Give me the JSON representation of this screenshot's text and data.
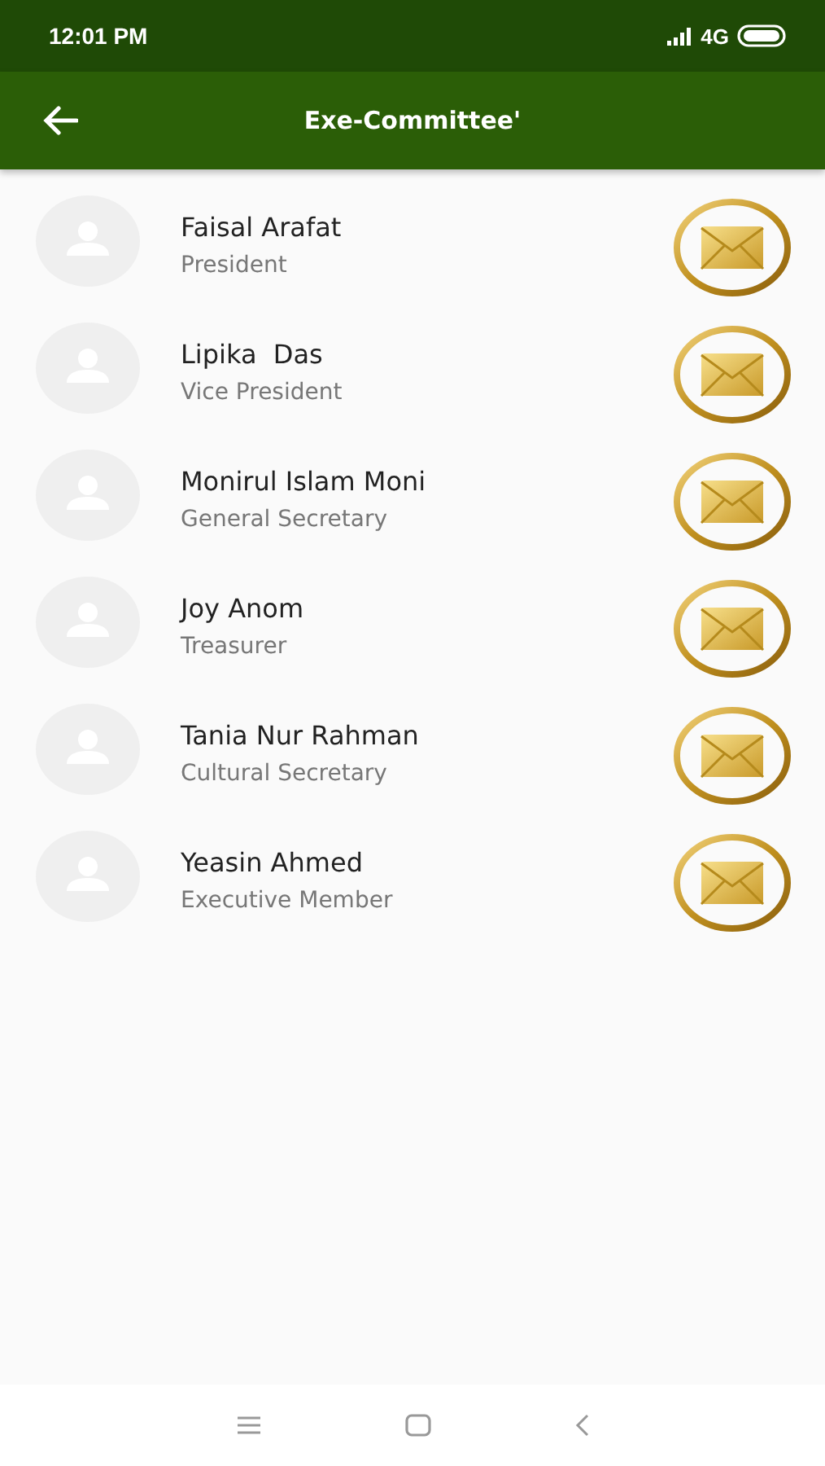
{
  "status_bar": {
    "time": "12:01 PM",
    "network": "4G"
  },
  "app_bar": {
    "title": "Exe-Committee'"
  },
  "members": [
    {
      "name": "Faisal Arafat",
      "role": "President"
    },
    {
      "name": "Lipika  Das",
      "role": "Vice President"
    },
    {
      "name": "Monirul Islam Moni",
      "role": "General Secretary"
    },
    {
      "name": "Joy Anom",
      "role": "Treasurer"
    },
    {
      "name": "Tania Nur Rahman",
      "role": "Cultural Secretary"
    },
    {
      "name": "Yeasin Ahmed",
      "role": "Executive Member"
    }
  ]
}
